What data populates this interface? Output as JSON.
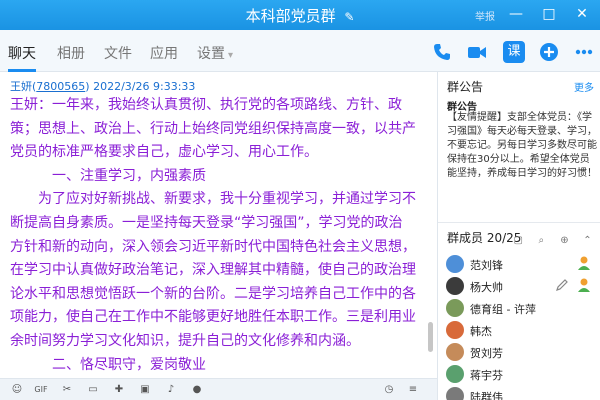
{
  "window": {
    "title": "本科部党员群",
    "report": "举报",
    "controls": {
      "minimize": "—",
      "maximize": "□",
      "close": "✕"
    }
  },
  "tabs": [
    {
      "label": "聊天",
      "active": true
    },
    {
      "label": "相册",
      "active": false
    },
    {
      "label": "文件",
      "active": false
    },
    {
      "label": "应用",
      "active": false
    },
    {
      "label": "设置",
      "active": false
    }
  ],
  "toolbar": {
    "class_label": "课",
    "icons": [
      "phone-icon",
      "video-icon",
      "class-icon",
      "add-icon",
      "more-icon"
    ]
  },
  "message": {
    "sender": "王妍",
    "qq_open": "(",
    "qq": "7800565",
    "qq_close": ")",
    "time": "2022/3/26 9:33:33",
    "text_color": "#8a1fd6",
    "lines": [
      "王妍：一年来，我始终认真贯彻、执行党的各项路线、方针、政",
      "策；思想上、政治上、行动上始终同党组织保持高度一致，以共产",
      "党员的标准严格要求自己，虚心学习、用心工作。"
    ],
    "section1": "一、注重学习，内强素质",
    "paragraph1_lines": [
      "为了应对好新挑战、新要求，我十分重视学习，并通过学习不",
      "断提高自身素质。一是坚持每天登录“学习强国”，学习党的政治",
      "方针和新的动向，深入领会习近平新时代中国特色社会主义思想，",
      "在学习中认真做好政治笔记，深入理解其中精髓，使自己的政治理",
      "论水平和思想觉悟跃一个新的台阶。二是学习培养自己工作中的各",
      "项能力，使自己在工作中不能够更好地胜任本职工作。三是利用业",
      "余时间努力学习文化知识，提升自己的文化修养和内涵。"
    ],
    "section2": "二、恪尽职守，爱岗敬业"
  },
  "notice": {
    "header": "群公告",
    "more": "更多",
    "title": "群公告",
    "text": "【友情提醒】支部全体党员：《学习强国》每天必每天登录、学习，不要忘记。另每日学习多数尽可能保持在30分以上。希望全体党员能坚持，养成每日学习的好习惯！"
  },
  "members": {
    "header": "群成员 20/25",
    "list": [
      {
        "name": "范刘锋",
        "avatar_color": "#4e8fd8",
        "badge": "admin"
      },
      {
        "name": "杨大帅",
        "avatar_color": "#3b3b3b",
        "badge": "owner"
      },
      {
        "name": "德育组 - 许萍",
        "avatar_color": "#7a9a5a",
        "badge": ""
      },
      {
        "name": "韩杰",
        "avatar_color": "#d86a3a",
        "badge": ""
      },
      {
        "name": "贺刘芳",
        "avatar_color": "#c58b5a",
        "badge": ""
      },
      {
        "name": "蒋宇芬",
        "avatar_color": "#5aa06e",
        "badge": ""
      },
      {
        "name": "陆群伟",
        "avatar_color": "#7a7a7a",
        "badge": ""
      }
    ]
  },
  "colors": {
    "titlebar": "#1a93e3",
    "accent": "#1a8cf0",
    "link": "#1a6fd0"
  }
}
